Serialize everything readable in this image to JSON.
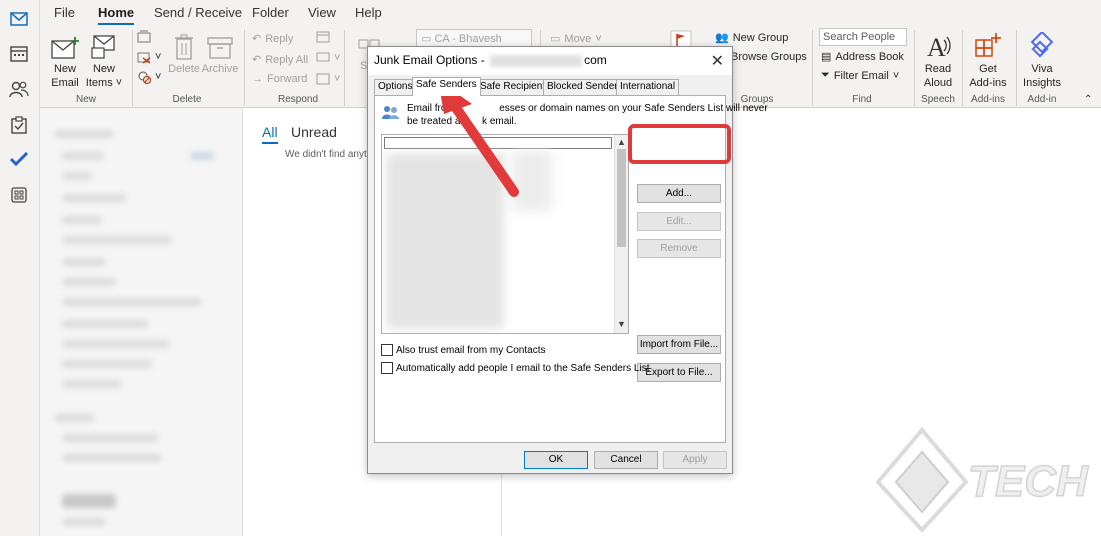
{
  "menu": {
    "tabs": [
      {
        "label": "File"
      },
      {
        "label": "Home"
      },
      {
        "label": "Send / Receive"
      },
      {
        "label": "Folder"
      },
      {
        "label": "View"
      },
      {
        "label": "Help"
      }
    ],
    "active_tab": "Home"
  },
  "ribbon": {
    "new_email": "New\nEmail",
    "new_email_l1": "New",
    "new_email_l2": "Email",
    "new_items_l1": "New",
    "new_items_l2": "Items",
    "delete": "Delete",
    "archive": "Archive",
    "reply": "Reply",
    "reply_all": "Reply All",
    "forward": "Forward",
    "move_to_value": "CA - Bhavesh",
    "move": "Move",
    "new_group": "New Group",
    "browse_groups": "Browse Groups",
    "search_people_placeholder": "Search People",
    "address_book": "Address Book",
    "filter_email": "Filter Email",
    "read_aloud_l1": "Read",
    "read_aloud_l2": "Aloud",
    "get_addins_l1": "Get",
    "get_addins_l2": "Add-ins",
    "viva_l1": "Viva",
    "viva_l2": "Insights",
    "groups": {
      "new": "New",
      "delete": "Delete",
      "respond": "Respond",
      "groups": "Groups",
      "find": "Find",
      "speech": "Speech",
      "addins": "Add-ins",
      "addin": "Add-in"
    }
  },
  "message_list": {
    "tab_all": "All",
    "tab_unread": "Unread",
    "empty_text": "We didn't find anythi"
  },
  "dialog": {
    "title_prefix": "Junk Email Options -",
    "title_suffix": "com",
    "close": "✕",
    "tabs": [
      {
        "label": "Options"
      },
      {
        "label": "Safe Senders"
      },
      {
        "label": "Safe Recipients"
      },
      {
        "label": "Blocked Senders"
      },
      {
        "label": "International"
      }
    ],
    "selected_tab": "Safe Senders",
    "info_line1": "Email from                esses or domain names on your Safe Senders List will never",
    "info_line2": "be treated as      k email.",
    "buttons": {
      "add": "Add...",
      "edit": "Edit...",
      "remove": "Remove",
      "import": "Import from File...",
      "export": "Export to File..."
    },
    "checkbox_contacts": "Also trust email from my Contacts",
    "checkbox_autoadd": "Automatically add people I email to the Safe Senders List",
    "ok": "OK",
    "cancel": "Cancel",
    "apply": "Apply"
  },
  "colors": {
    "accent": "#0f6cbd",
    "highlight": "#e03a3a"
  }
}
